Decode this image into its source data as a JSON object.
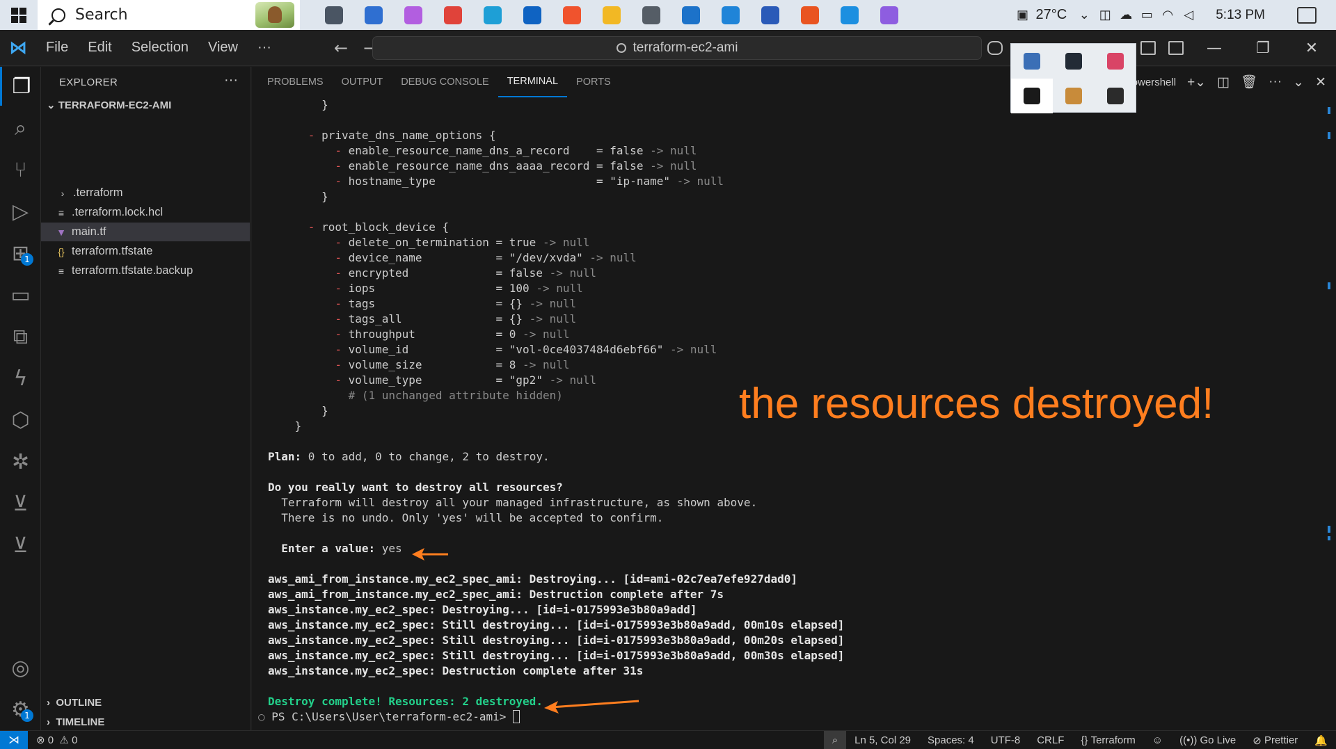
{
  "taskbar": {
    "search_placeholder": "Search",
    "temperature": "27°C",
    "time": "5:13 PM",
    "apps": [
      {
        "icon": "task-view-icon",
        "color": "#4a5563"
      },
      {
        "icon": "store-icon",
        "color": "#2f6fd1"
      },
      {
        "icon": "copilot-icon",
        "color": "#b25ee0"
      },
      {
        "icon": "chrome-icon",
        "color": "#e0433a"
      },
      {
        "icon": "edge-icon",
        "color": "#1e9fd6"
      },
      {
        "icon": "outlook-icon",
        "color": "#0f63c2"
      },
      {
        "icon": "brave-icon",
        "color": "#f0532d"
      },
      {
        "icon": "file-explorer-icon",
        "color": "#f2b824"
      },
      {
        "icon": "settings-icon",
        "color": "#555d66"
      },
      {
        "icon": "remote-desktop-icon",
        "color": "#1c72c9"
      },
      {
        "icon": "azure-data-studio-icon",
        "color": "#1f84d8"
      },
      {
        "icon": "powershell-icon",
        "color": "#2a5ab8"
      },
      {
        "icon": "ubuntu-icon",
        "color": "#e95420"
      },
      {
        "icon": "vscode-taskbar-icon",
        "color": "#1c8fe0"
      },
      {
        "icon": "git-kraken-icon",
        "color": "#8e5de0"
      }
    ]
  },
  "titlebar": {
    "menu": [
      "File",
      "Edit",
      "Selection",
      "View",
      "···"
    ],
    "command_center": "terraform-ec2-ami"
  },
  "tray_popup": {
    "icons": [
      {
        "icon": "display-icon",
        "color": "#3b6fb6"
      },
      {
        "icon": "defender-icon",
        "color": "#222b36"
      },
      {
        "icon": "snipping-icon",
        "color": "#d94466"
      },
      {
        "icon": "notion-icon",
        "color": "#1a1a1a"
      },
      {
        "icon": "word-icon",
        "color": "#c88b3a"
      },
      {
        "icon": "bitlocker-icon",
        "color": "#2b2b2b"
      }
    ]
  },
  "explorer": {
    "title": "EXPLORER",
    "folder": "TERRAFORM-EC2-AMI",
    "items": [
      {
        "label": ".terraform",
        "icon": "›",
        "selected": false
      },
      {
        "label": ".terraform.lock.hcl",
        "icon": "≡",
        "selected": false
      },
      {
        "label": "main.tf",
        "icon": "▼",
        "selected": true
      },
      {
        "label": "terraform.tfstate",
        "icon": "{}",
        "selected": false
      },
      {
        "label": "terraform.tfstate.backup",
        "icon": "≡",
        "selected": false
      }
    ],
    "outline": "OUTLINE",
    "timeline": "TIMELINE"
  },
  "activity_badges": {
    "extensions": "1",
    "accounts": "1"
  },
  "panel": {
    "tabs": [
      "PROBLEMS",
      "OUTPUT",
      "DEBUG CONSOLE",
      "TERMINAL",
      "PORTS"
    ],
    "active_tab": "TERMINAL",
    "shell": "powershell"
  },
  "terminal": {
    "lines": [
      {
        "kind": "plain",
        "indent": "        ",
        "text": "}"
      },
      {
        "kind": "blank"
      },
      {
        "kind": "attr_block",
        "indent": "      ",
        "text": "private_dns_name_options {"
      },
      {
        "kind": "attr",
        "indent": "          ",
        "key": "enable_resource_name_dns_a_record    ",
        "val": "= false",
        "tail": " -> null"
      },
      {
        "kind": "attr",
        "indent": "          ",
        "key": "enable_resource_name_dns_aaaa_record ",
        "val": "= false",
        "tail": " -> null"
      },
      {
        "kind": "attr",
        "indent": "          ",
        "key": "hostname_type                        ",
        "val": "= \"ip-name\"",
        "tail": " -> null"
      },
      {
        "kind": "plain",
        "indent": "        ",
        "text": "}"
      },
      {
        "kind": "blank"
      },
      {
        "kind": "attr_block",
        "indent": "      ",
        "text": "root_block_device {"
      },
      {
        "kind": "attr",
        "indent": "          ",
        "key": "delete_on_termination ",
        "val": "= true",
        "tail": " -> null"
      },
      {
        "kind": "attr",
        "indent": "          ",
        "key": "device_name           ",
        "val": "= \"/dev/xvda\"",
        "tail": " -> null"
      },
      {
        "kind": "attr",
        "indent": "          ",
        "key": "encrypted             ",
        "val": "= false",
        "tail": " -> null"
      },
      {
        "kind": "attr",
        "indent": "          ",
        "key": "iops                  ",
        "val": "= 100",
        "tail": " -> null"
      },
      {
        "kind": "attr",
        "indent": "          ",
        "key": "tags                  ",
        "val": "= {}",
        "tail": " -> null"
      },
      {
        "kind": "attr",
        "indent": "          ",
        "key": "tags_all              ",
        "val": "= {}",
        "tail": " -> null"
      },
      {
        "kind": "attr",
        "indent": "          ",
        "key": "throughput            ",
        "val": "= 0",
        "tail": " -> null"
      },
      {
        "kind": "attr",
        "indent": "          ",
        "key": "volume_id             ",
        "val": "= \"vol-0ce4037484d6ebf66\"",
        "tail": " -> null"
      },
      {
        "kind": "attr",
        "indent": "          ",
        "key": "volume_size           ",
        "val": "= 8",
        "tail": " -> null"
      },
      {
        "kind": "attr",
        "indent": "          ",
        "key": "volume_type           ",
        "val": "= \"gp2\"",
        "tail": " -> null"
      },
      {
        "kind": "dim",
        "indent": "            ",
        "text": "# (1 unchanged attribute hidden)"
      },
      {
        "kind": "plain",
        "indent": "        ",
        "text": "}"
      },
      {
        "kind": "plain",
        "indent": "    ",
        "text": "}"
      },
      {
        "kind": "blank"
      },
      {
        "kind": "plan",
        "label": "Plan:",
        "text": " 0 to add, 0 to change, 2 to destroy."
      },
      {
        "kind": "blank"
      },
      {
        "kind": "bold",
        "indent": "",
        "text": "Do you really want to destroy all resources?"
      },
      {
        "kind": "plain",
        "indent": "  ",
        "text": "Terraform will destroy all your managed infrastructure, as shown above."
      },
      {
        "kind": "plain",
        "indent": "  ",
        "text": "There is no undo. Only 'yes' will be accepted to confirm."
      },
      {
        "kind": "blank"
      },
      {
        "kind": "prompt",
        "indent": "  ",
        "label": "Enter a value:",
        "text": " yes"
      },
      {
        "kind": "blank"
      },
      {
        "kind": "bold",
        "indent": "",
        "text": "aws_ami_from_instance.my_ec2_spec_ami: Destroying... [id=ami-02c7ea7efe927dad0]"
      },
      {
        "kind": "bold",
        "indent": "",
        "text": "aws_ami_from_instance.my_ec2_spec_ami: Destruction complete after 7s"
      },
      {
        "kind": "bold",
        "indent": "",
        "text": "aws_instance.my_ec2_spec: Destroying... [id=i-0175993e3b80a9add]"
      },
      {
        "kind": "bold",
        "indent": "",
        "text": "aws_instance.my_ec2_spec: Still destroying... [id=i-0175993e3b80a9add, 00m10s elapsed]"
      },
      {
        "kind": "bold",
        "indent": "",
        "text": "aws_instance.my_ec2_spec: Still destroying... [id=i-0175993e3b80a9add, 00m20s elapsed]"
      },
      {
        "kind": "bold",
        "indent": "",
        "text": "aws_instance.my_ec2_spec: Still destroying... [id=i-0175993e3b80a9add, 00m30s elapsed]"
      },
      {
        "kind": "bold",
        "indent": "",
        "text": "aws_instance.my_ec2_spec: Destruction complete after 31s"
      },
      {
        "kind": "blank"
      },
      {
        "kind": "green",
        "indent": "",
        "text": "Destroy complete! Resources: 2 destroyed."
      },
      {
        "kind": "ps",
        "indent": "",
        "text": "PS C:\\Users\\User\\terraform-ec2-ami> "
      }
    ]
  },
  "annotation": {
    "text": "the resources destroyed!",
    "color": "#ff7e1f"
  },
  "statusbar": {
    "errors": "0",
    "warnings": "0",
    "position": "Ln 5, Col 29",
    "spaces": "Spaces: 4",
    "encoding": "UTF-8",
    "eol": "CRLF",
    "language": "Terraform",
    "golive": "Go Live",
    "prettier": "Prettier"
  }
}
